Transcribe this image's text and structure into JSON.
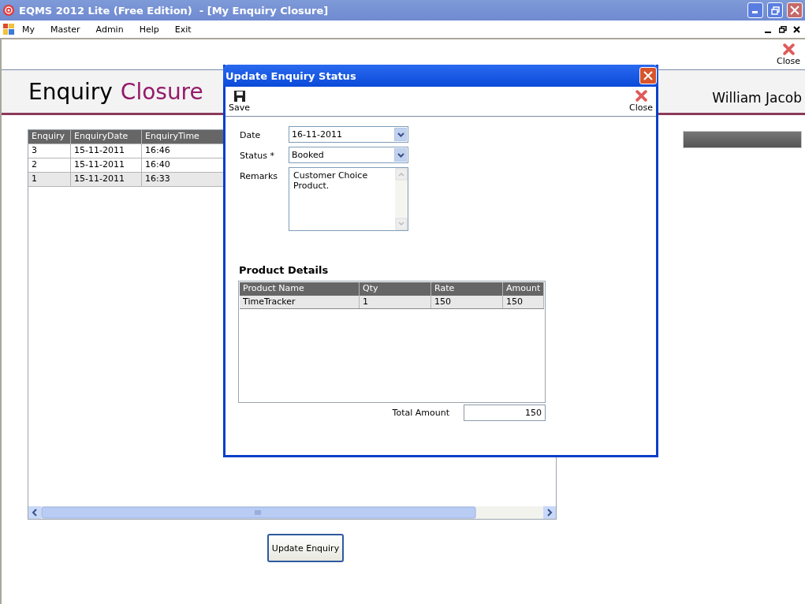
{
  "window": {
    "title": "EQMS 2012 Lite (Free Edition)  - [My Enquiry Closure]"
  },
  "menu": [
    "My",
    "Master",
    "Admin",
    "Help",
    "Exit"
  ],
  "toolbar": {
    "close": "Close"
  },
  "header": {
    "title": "Enquiry",
    "title_accent": "Closure",
    "user": "William Jacob"
  },
  "enquiries": {
    "columns": [
      "Enquiry",
      "EnquiryDate",
      "EnquiryTime"
    ],
    "rows": [
      {
        "cells": [
          "3",
          "15-11-2011",
          "16:46"
        ],
        "selected": false
      },
      {
        "cells": [
          "2",
          "15-11-2011",
          "16:40"
        ],
        "selected": false
      },
      {
        "cells": [
          "1",
          "15-11-2011",
          "16:33"
        ],
        "selected": true
      }
    ]
  },
  "update_button": "Update Enquiry",
  "dialog": {
    "title": "Update Enquiry Status",
    "save": "Save",
    "close": "Close",
    "fields": [
      {
        "kind": "dropdown",
        "label": "Date",
        "value": "16-11-2011"
      },
      {
        "kind": "dropdown",
        "label": "Status *",
        "value": "Booked"
      },
      {
        "kind": "textarea",
        "label": "Remarks",
        "value": "Customer Choice\nProduct."
      }
    ],
    "products_title": "Product Details",
    "products": {
      "columns": [
        "Product Name",
        "Qty",
        "Rate",
        "Amount"
      ],
      "rows": [
        {
          "cells": [
            "TimeTracker",
            "1",
            "150",
            "150"
          ],
          "selected": true
        }
      ]
    },
    "total_label": "Total Amount",
    "total_value": "150"
  }
}
